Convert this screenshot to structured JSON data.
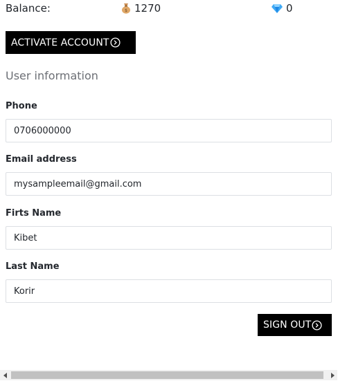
{
  "balance": {
    "label": "Balance:",
    "coins": "1270",
    "gems": "0",
    "coin_icon": "money-bag-icon",
    "gem_icon": "diamond-icon"
  },
  "actions": {
    "activate_label": "ACTIVATE ACCOUNT",
    "signout_label": "SIGN OUT",
    "arrow_icon": "circle-arrow-right-icon"
  },
  "section": {
    "title": "User information"
  },
  "fields": [
    {
      "label": "Phone",
      "value": "0706000000"
    },
    {
      "label": "Email address",
      "value": "mysampleemail@gmail.com"
    },
    {
      "label": "Firts Name",
      "value": "Kibet"
    },
    {
      "label": "Last Name",
      "value": "Korir"
    }
  ],
  "colors": {
    "button_bg": "#000000",
    "button_text": "#ffffff",
    "input_border": "#dcdfe3",
    "section_title": "#6c6f75"
  }
}
